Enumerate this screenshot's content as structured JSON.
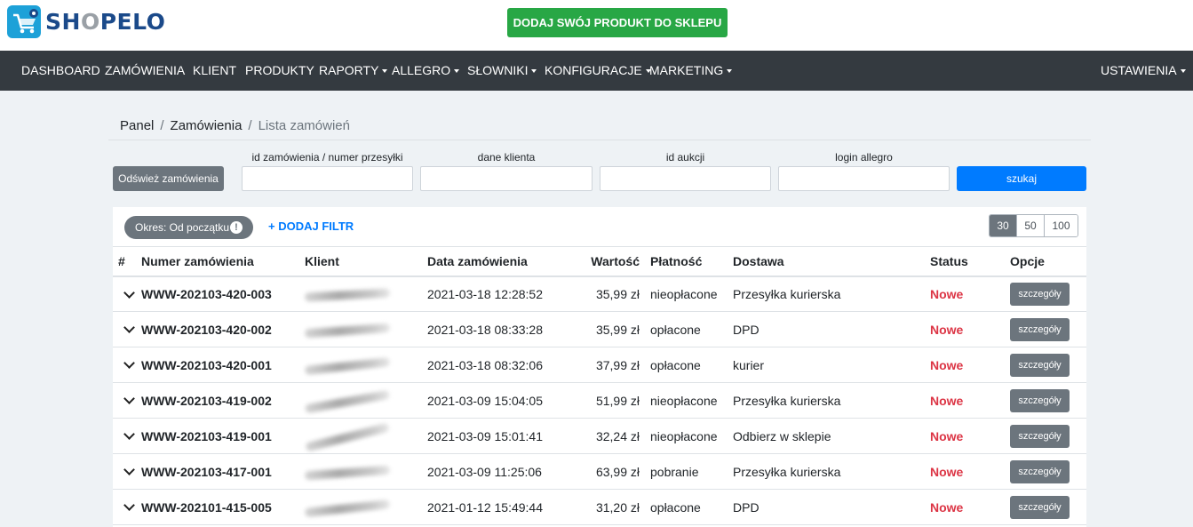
{
  "brand": {
    "name_part1": "SH",
    "name_o": "O",
    "name_part2": "PELO"
  },
  "promo_button": "DODAJ SWÓJ PRODUKT DO SKLEPU",
  "nav": {
    "dashboard": "DASHBOARD",
    "zamowienia": "ZAMÓWIENIA",
    "klient": "KLIENT",
    "produkty": "PRODUKTY",
    "raporty": "RAPORTY",
    "allegro": "ALLEGRO",
    "slowniki": "SŁOWNIKI",
    "konfiguracje": "KONFIGURACJE",
    "marketing": "MARKETING",
    "ustawienia": "USTAWIENIA"
  },
  "breadcrumb": {
    "panel": "Panel",
    "sep": "/",
    "orders": "Zamówienia",
    "current": "Lista zamówień"
  },
  "filters": {
    "refresh": "Odśwież zamówienia",
    "order_id_label": "id zamówienia / numer przesyłki",
    "client_label": "dane klienta",
    "auction_label": "id aukcji",
    "login_label": "login allegro",
    "search": "szukaj"
  },
  "toolbar": {
    "period": "Okres: Od początku",
    "add_filter": "+ DODAJ FILTR",
    "page_sizes": [
      "30",
      "50",
      "100"
    ],
    "active_page_size": "30"
  },
  "table": {
    "headers": {
      "hash": "#",
      "number": "Numer zamówienia",
      "client": "Klient",
      "date": "Data zamówienia",
      "value": "Wartość",
      "payment": "Płatność",
      "delivery": "Dostawa",
      "status": "Status",
      "options": "Opcje"
    },
    "rows": [
      {
        "number": "WWW-202103-420-003",
        "date": "2021-03-18 12:28:52",
        "value": "35,99 zł",
        "payment": "nieopłacone",
        "delivery": "Przesyłka kurierska",
        "status": "Nowe",
        "action": "szczegóły"
      },
      {
        "number": "WWW-202103-420-002",
        "date": "2021-03-18 08:33:28",
        "value": "35,99 zł",
        "payment": "opłacone",
        "delivery": "DPD",
        "status": "Nowe",
        "action": "szczegóły"
      },
      {
        "number": "WWW-202103-420-001",
        "date": "2021-03-18 08:32:06",
        "value": "37,99 zł",
        "payment": "opłacone",
        "delivery": "kurier",
        "status": "Nowe",
        "action": "szczegóły"
      },
      {
        "number": "WWW-202103-419-002",
        "date": "2021-03-09 15:04:05",
        "value": "51,99 zł",
        "payment": "nieopłacone",
        "delivery": "Przesyłka kurierska",
        "status": "Nowe",
        "action": "szczegóły"
      },
      {
        "number": "WWW-202103-419-001",
        "date": "2021-03-09 15:01:41",
        "value": "32,24 zł",
        "payment": "nieopłacone",
        "delivery": "Odbierz w sklepie",
        "status": "Nowe",
        "action": "szczegóły"
      },
      {
        "number": "WWW-202103-417-001",
        "date": "2021-03-09 11:25:06",
        "value": "63,99 zł",
        "payment": "pobranie",
        "delivery": "Przesyłka kurierska",
        "status": "Nowe",
        "action": "szczegóły"
      },
      {
        "number": "WWW-202101-415-005",
        "date": "2021-01-12 15:49:44",
        "value": "31,20 zł",
        "payment": "opłacone",
        "delivery": "DPD",
        "status": "Nowe",
        "action": "szczegóły"
      }
    ]
  }
}
